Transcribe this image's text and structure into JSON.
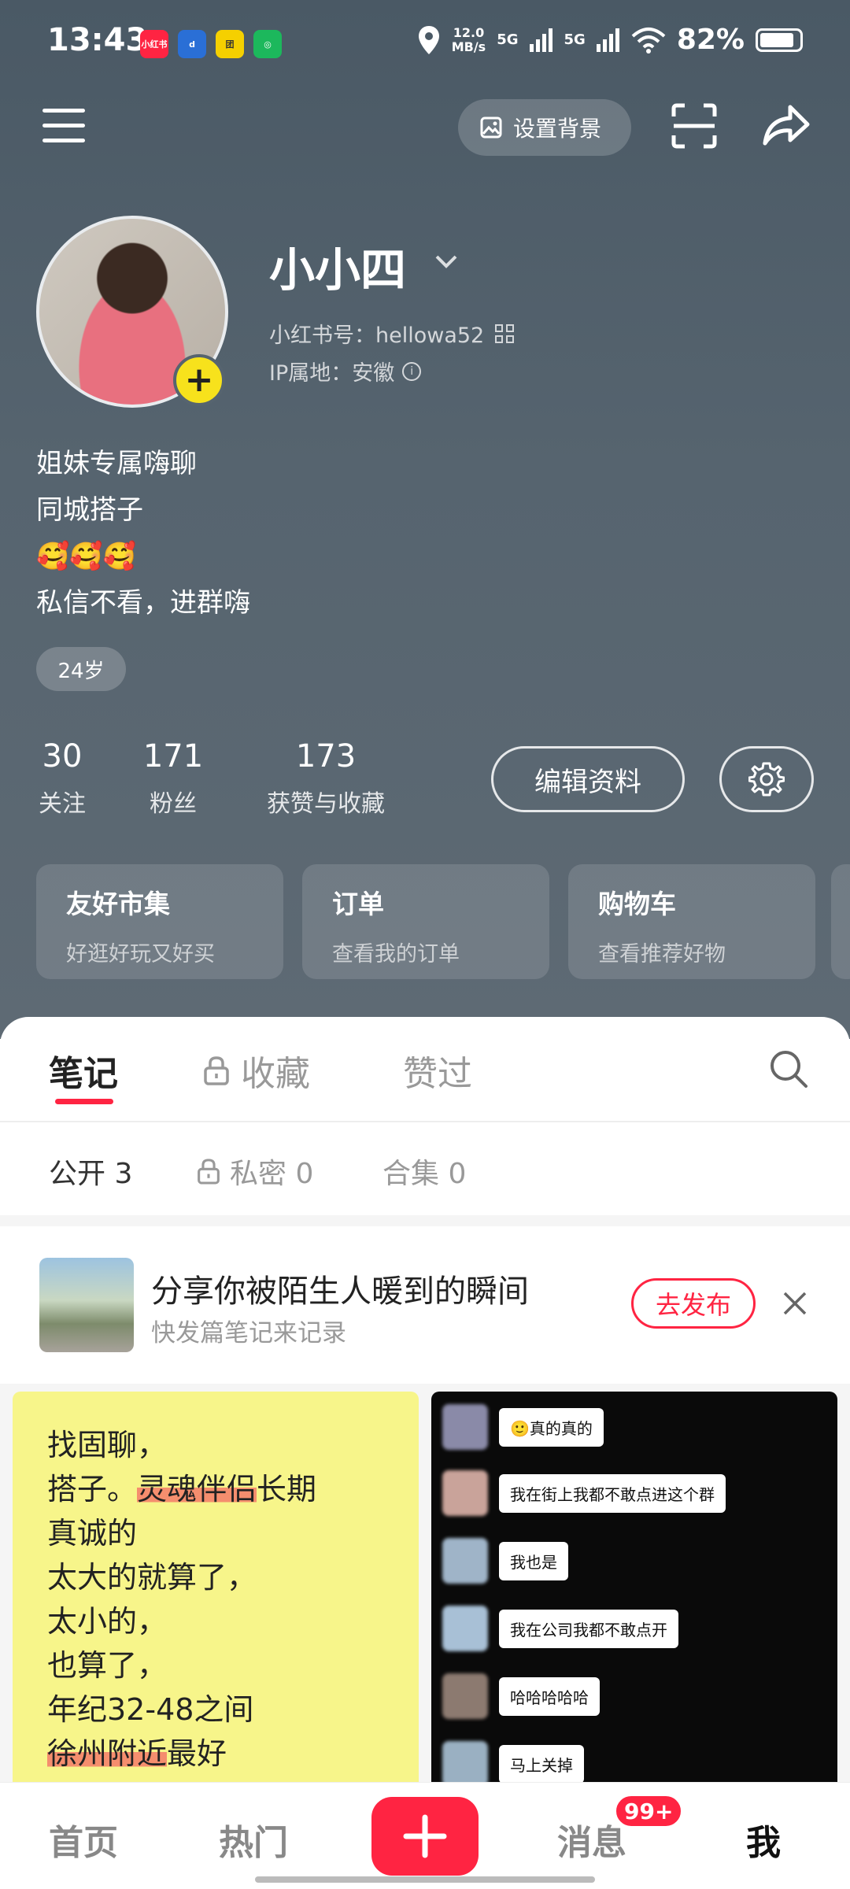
{
  "status_bar": {
    "time": "13:43",
    "app_badges": [
      {
        "label": "小红书",
        "color": "#ff2442"
      },
      {
        "label": "d",
        "color": "#2a6fd6"
      },
      {
        "label": "团",
        "color": "#f5d000"
      },
      {
        "label": "◎",
        "color": "#1cb85c"
      }
    ],
    "net_speed_value": "12.0",
    "net_speed_unit": "MB/s",
    "sig1": "5G",
    "sig2": "5G",
    "battery": "82%"
  },
  "top_bar": {
    "set_background_label": "设置背景"
  },
  "profile": {
    "nickname": "小小四",
    "red_id_label": "小红书号：hellowa52",
    "ip_label": "IP属地：安徽",
    "bio_lines": [
      "姐妹专属嗨聊",
      "同城搭子",
      "🥰🥰🥰",
      "私信不看，进群嗨"
    ],
    "age_tag": "24岁"
  },
  "stats": [
    {
      "num": "30",
      "label": "关注"
    },
    {
      "num": "171",
      "label": "粉丝"
    },
    {
      "num": "173",
      "label": "获赞与收藏"
    }
  ],
  "edit_profile_label": "编辑资料",
  "shortcut_cards": [
    {
      "title": "友好市集",
      "sub": "好逛好玩又好买"
    },
    {
      "title": "订单",
      "sub": "查看我的订单"
    },
    {
      "title": "购物车",
      "sub": "查看推荐好物"
    }
  ],
  "tabs": [
    {
      "label": "笔记"
    },
    {
      "label": "收藏"
    },
    {
      "label": "赞过"
    }
  ],
  "subtabs": [
    {
      "label": "公开 3"
    },
    {
      "label": "私密 0"
    },
    {
      "label": "合集 0"
    }
  ],
  "promo": {
    "title": "分享你被陌生人暖到的瞬间",
    "subtitle": "快发篇笔记来记录",
    "button": "去发布"
  },
  "note1": {
    "lines": [
      {
        "a": "找固聊，",
        "h": "",
        "b": ""
      },
      {
        "a": "搭子。",
        "h": "灵魂伴侣",
        "b": "长期"
      },
      {
        "a": "真诚的",
        "h": "",
        "b": ""
      },
      {
        "a": "太大的就算了，",
        "h": "",
        "b": ""
      },
      {
        "a": "太小的，",
        "h": "",
        "b": ""
      },
      {
        "a": "也算了，",
        "h": "",
        "b": ""
      },
      {
        "a": "年纪32-48之间",
        "h": "",
        "b": ""
      },
      {
        "a": "",
        "h": "徐州附近",
        "b": "最好"
      }
    ]
  },
  "note2": {
    "messages": [
      "🙂真的真的",
      "我在街上我都不敢点进这个群",
      "我也是",
      "我在公司我都不敢点开",
      "哈哈哈哈哈",
      "马上关掉"
    ]
  },
  "bottom_nav": {
    "home": "首页",
    "hot": "热门",
    "messages": "消息",
    "messages_badge": "99+",
    "me": "我"
  }
}
